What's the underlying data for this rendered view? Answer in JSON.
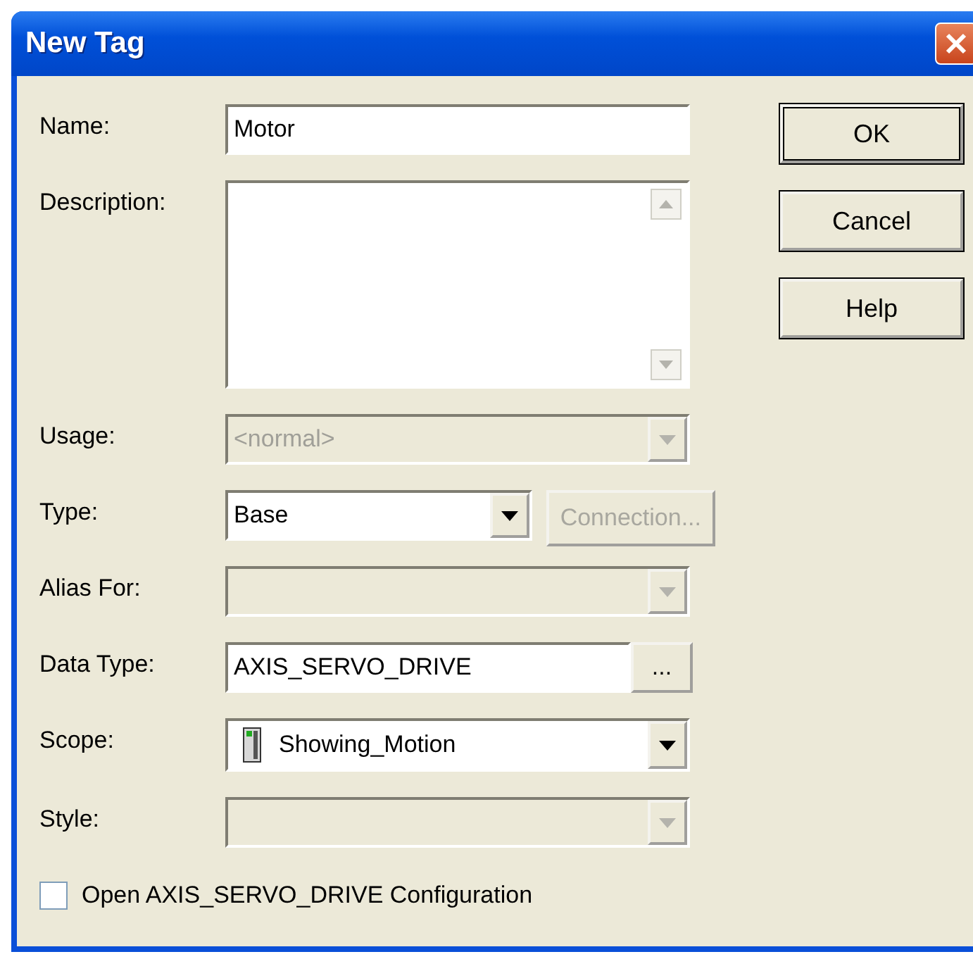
{
  "window": {
    "title": "New Tag"
  },
  "fields": [
    {
      "kind": "text",
      "label": "Name:",
      "value": "Motor",
      "disabled": false
    },
    {
      "kind": "textarea",
      "label": "Description:",
      "disabled": false
    },
    {
      "kind": "combo",
      "label": "Usage:",
      "value": "<normal>",
      "disabled": true
    },
    {
      "kind": "combo-button",
      "label": "Type:",
      "value": "Base",
      "disabled": false,
      "button": "Connection...",
      "button_disabled": true
    },
    {
      "kind": "combo",
      "label": "Alias For:",
      "disabled": true
    },
    {
      "kind": "text-button",
      "label": "Data Type:",
      "value": "AXIS_SERVO_DRIVE",
      "disabled": false,
      "button": "..."
    },
    {
      "kind": "combo-icon",
      "label": "Scope:",
      "value": "Showing_Motion",
      "disabled": false
    },
    {
      "kind": "combo",
      "label": "Style:",
      "disabled": true
    }
  ],
  "checkbox": {
    "label": "Open AXIS_SERVO_DRIVE Configuration",
    "checked": false
  },
  "buttons": [
    "OK",
    "Cancel",
    "Help"
  ]
}
